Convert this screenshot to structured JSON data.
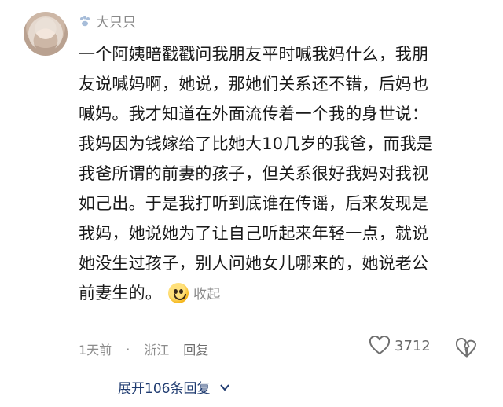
{
  "user": {
    "name": "大只只",
    "badge_icon": "paw-icon"
  },
  "comment": {
    "lines": [
      "一个阿姨暗戳戳问我朋友平时喊我妈什么，我朋",
      "友说喊妈啊，她说，那她们关系还不错，后妈也",
      "喊妈。我才知道在外面流传着一个我的身世说：",
      "我妈因为钱嫁给了比她大10几岁的我爸，而我是",
      "我爸所谓的前妻的孩子，但关系很好我妈对我视",
      "如己出。于是我打听到底谁在传谣，后来发现是",
      "我妈，她说她为了让自己听起来年轻一点，就说",
      "她没生过孩子，别人问她女儿哪来的，她说老公"
    ],
    "last_line": "前妻生的。",
    "collapse_label": "收起"
  },
  "meta": {
    "time": "1天前",
    "location": "浙江",
    "reply_label": "回复",
    "like_count": "3712"
  },
  "replies": {
    "expand_label": "展开106条回复"
  },
  "colors": {
    "link": "#1f3b70",
    "muted": "#8a8a8a"
  }
}
